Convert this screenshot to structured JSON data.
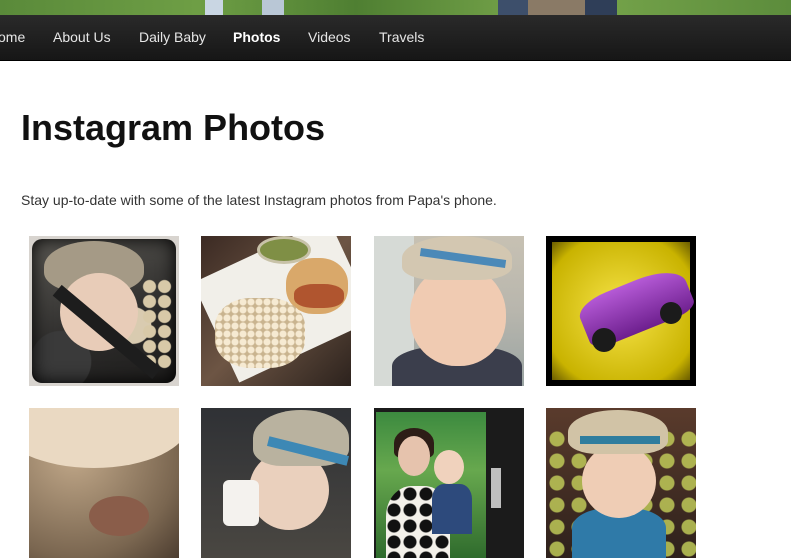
{
  "nav": {
    "items": [
      {
        "label": "ome",
        "active": false
      },
      {
        "label": "About Us",
        "active": false
      },
      {
        "label": "Daily Baby",
        "active": false
      },
      {
        "label": "Photos",
        "active": true
      },
      {
        "label": "Videos",
        "active": false
      },
      {
        "label": "Travels",
        "active": false
      }
    ]
  },
  "main": {
    "title": "Instagram Photos",
    "intro": "Stay up-to-date with some of the latest Instagram photos from Papa's phone."
  },
  "photos": [
    {
      "subject": "toddler sleeping in car seat wearing hat"
    },
    {
      "subject": "food tray with rice and taco"
    },
    {
      "subject": "smiling toddler in fedora hat"
    },
    {
      "subject": "purple toy car on yellow background"
    },
    {
      "subject": "closeup of cup"
    },
    {
      "subject": "toddler in fedora drinking from cup"
    },
    {
      "subject": "woman holding toddler on phone screen"
    },
    {
      "subject": "toddler in fedora in stroller"
    }
  ]
}
